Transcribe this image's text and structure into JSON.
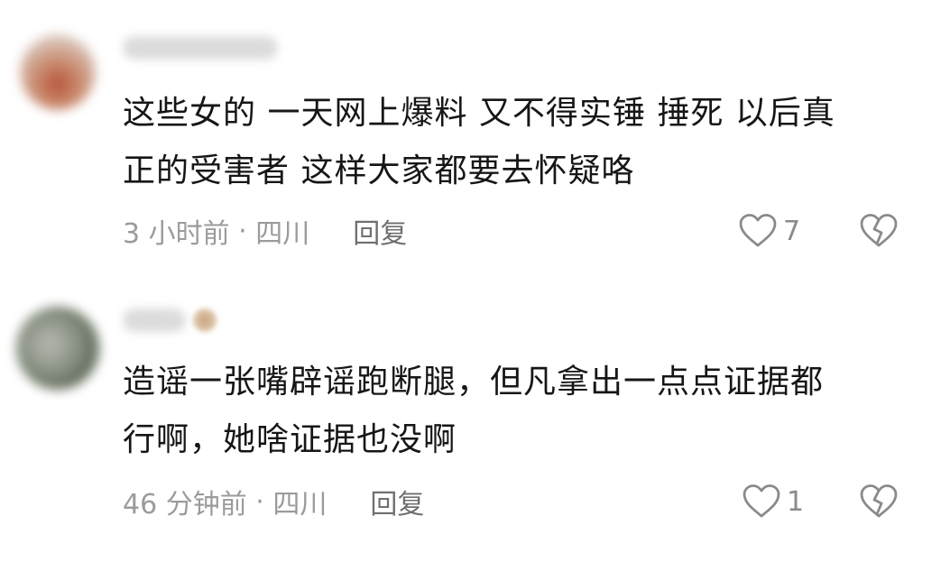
{
  "comments": [
    {
      "text_line1": "这些女的 一天网上爆料 又不得实锤 捶死 以后真",
      "text_line2": "正的受害者 这样大家都要去怀疑咯",
      "time": "3 小时前",
      "location": "四川",
      "reply_label": "回复",
      "likes": "7",
      "avatar_colors": [
        "#c9a48f",
        "#b8553a"
      ]
    },
    {
      "text_line1": "造谣一张嘴辟谣跑断腿，但凡拿出一点点证据都",
      "text_line2": "行啊，她啥证据也没啊",
      "time": "46 分钟前",
      "location": "四川",
      "reply_label": "回复",
      "likes": "1",
      "avatar_colors": [
        "#9a9f97",
        "#4e5a47"
      ]
    }
  ],
  "icons": {
    "like": "heart-outline-icon",
    "dislike": "broken-heart-icon"
  },
  "colors": {
    "text": "#161616",
    "meta": "#9b9b9b",
    "icon": "#8a8a8a"
  }
}
